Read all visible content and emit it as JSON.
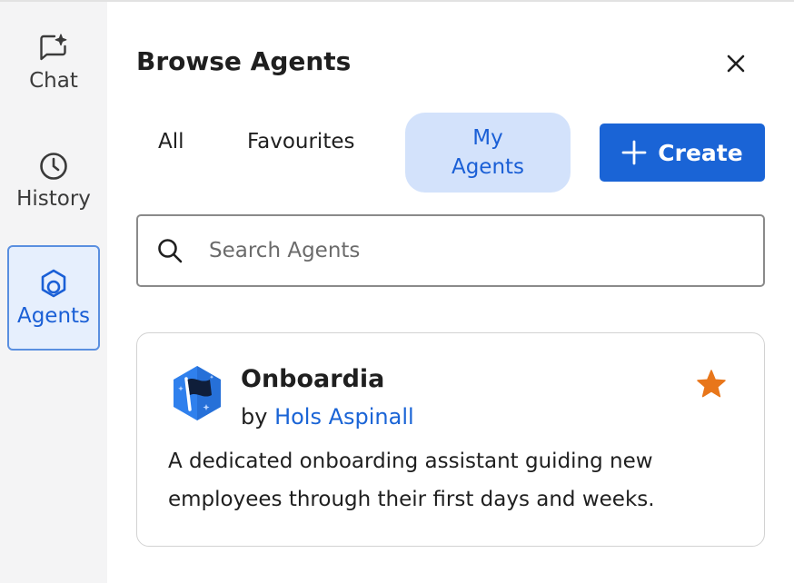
{
  "sidebar": {
    "items": [
      {
        "label": "Chat",
        "icon": "chat-sparkle-icon"
      },
      {
        "label": "History",
        "icon": "clock-icon"
      },
      {
        "label": "Agents",
        "icon": "agents-icon",
        "active": true
      }
    ]
  },
  "panel": {
    "title": "Browse Agents",
    "close_icon": "close-icon"
  },
  "tabs": [
    {
      "label": "All"
    },
    {
      "label": "Favourites"
    },
    {
      "label": "My\nAgents",
      "active": true
    }
  ],
  "create_button": {
    "label": "Create",
    "icon": "plus-icon"
  },
  "search": {
    "placeholder": "Search Agents",
    "value": "",
    "icon": "search-icon"
  },
  "agents": [
    {
      "name": "Onboardia",
      "by_prefix": "by",
      "author": "Hols Aspinall",
      "description": "A dedicated onboarding assistant guiding new employees through their first days and weeks.",
      "favourite": true,
      "avatar_icon": "flag-hexagon-icon"
    }
  ],
  "colors": {
    "accent": "#1a64d6",
    "active_tab_bg": "#d3e2fb",
    "sidebar_bg": "#f4f4f5",
    "active_nav_bg": "#e6effd",
    "active_nav_border": "#5a8fe0",
    "star": "#e8761a",
    "avatar_bg": "#2f80ed"
  }
}
